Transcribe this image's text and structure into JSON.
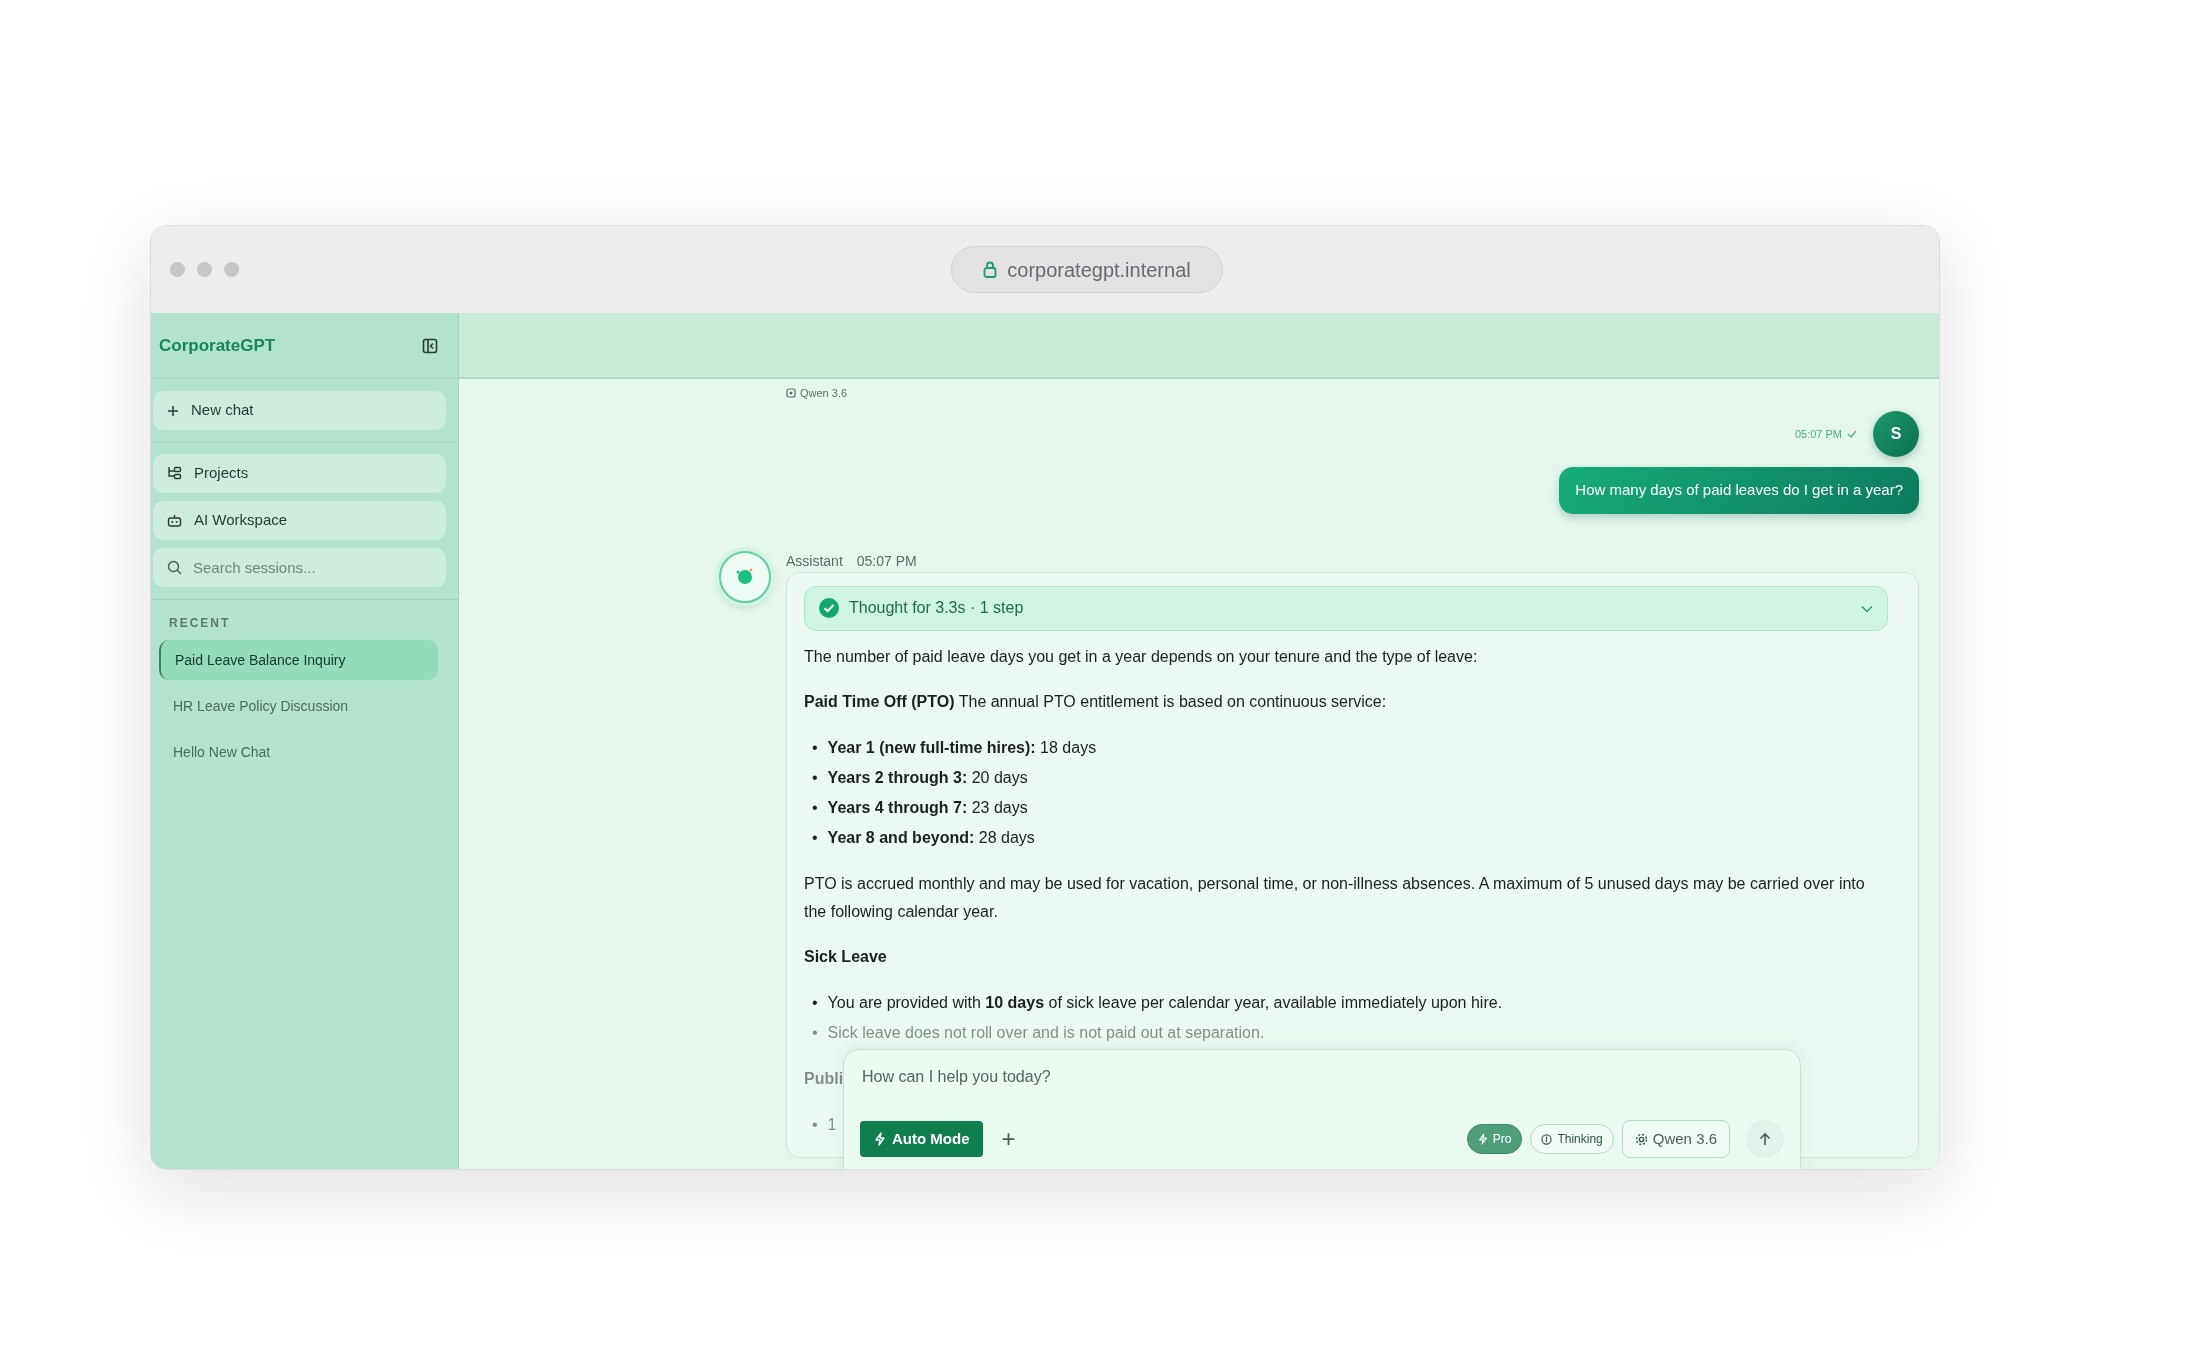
{
  "browser": {
    "address": "corporategpt.internal"
  },
  "sidebar": {
    "brand": "CorporateGPT",
    "new_chat": "New chat",
    "nav": [
      {
        "label": "Projects"
      },
      {
        "label": "AI Workspace"
      }
    ],
    "search": {
      "placeholder": "Search sessions..."
    },
    "recent_label": "RECENT",
    "sessions": [
      {
        "title": "Paid Leave Balance Inquiry",
        "selected": true
      },
      {
        "title": "HR Leave Policy Discussion",
        "selected": false
      },
      {
        "title": "Hello New Chat",
        "selected": false
      }
    ]
  },
  "chat": {
    "model_label": "Qwen 3.6",
    "user_message": {
      "time": "05:07 PM",
      "delivered": true,
      "avatar": "S",
      "text": "How many days of paid leaves do I get in a year?"
    },
    "assistant": {
      "name": "Assistant",
      "time": "05:07 PM",
      "thought": {
        "label": "Thought for 3.3s · 1 step",
        "done": true,
        "expanded": false
      },
      "blocks": [
        {
          "kind": "paragraph",
          "text": "The number of paid leave days you get in a year depends on your tenure and the type of leave:",
          "faded": false
        },
        {
          "kind": "paragraph",
          "text": "**Paid Time Off (PTO)** The annual PTO entitlement is based on continuous service:",
          "faded": false
        },
        {
          "kind": "list",
          "marker": "•",
          "items": [
            {
              "text": "**Year 1 (new full-time hires):** 18 days",
              "faded": false
            },
            {
              "text": "**Years 2 through 3:** 20 days",
              "faded": false
            },
            {
              "text": "**Years 4 through 7:** 23 days",
              "faded": false
            },
            {
              "text": "**Year 8 and beyond:** 28 days",
              "faded": false
            }
          ]
        },
        {
          "kind": "paragraph",
          "text": "PTO is accrued monthly and may be used for vacation, personal time, or non-illness absences. A maximum of 5 unused days may be carried over into the following calendar year.",
          "faded": false
        },
        {
          "kind": "heading",
          "text": "Sick Leave",
          "faded": false
        },
        {
          "kind": "list",
          "marker": "•",
          "items": [
            {
              "text": "You are provided with **10 days** of sick leave per calendar year, available immediately upon hire.",
              "faded": false
            },
            {
              "text": "Sick leave does not roll over and is not paid out at separation.",
              "faded": true
            }
          ]
        },
        {
          "kind": "heading",
          "text": "Publi",
          "faded": true
        },
        {
          "kind": "list",
          "marker": "•",
          "items": [
            {
              "text": "1",
              "faded": true
            }
          ]
        }
      ]
    }
  },
  "composer": {
    "placeholder": "How can I help you today?",
    "mode_button": "Auto Mode",
    "add_button": "+",
    "pills": [
      {
        "label": "Pro",
        "kind": "toggle",
        "selected": true
      },
      {
        "label": "Thinking",
        "kind": "toggle",
        "selected": false
      },
      {
        "label": "Qwen 3.6",
        "kind": "model",
        "selected": false
      }
    ]
  }
}
